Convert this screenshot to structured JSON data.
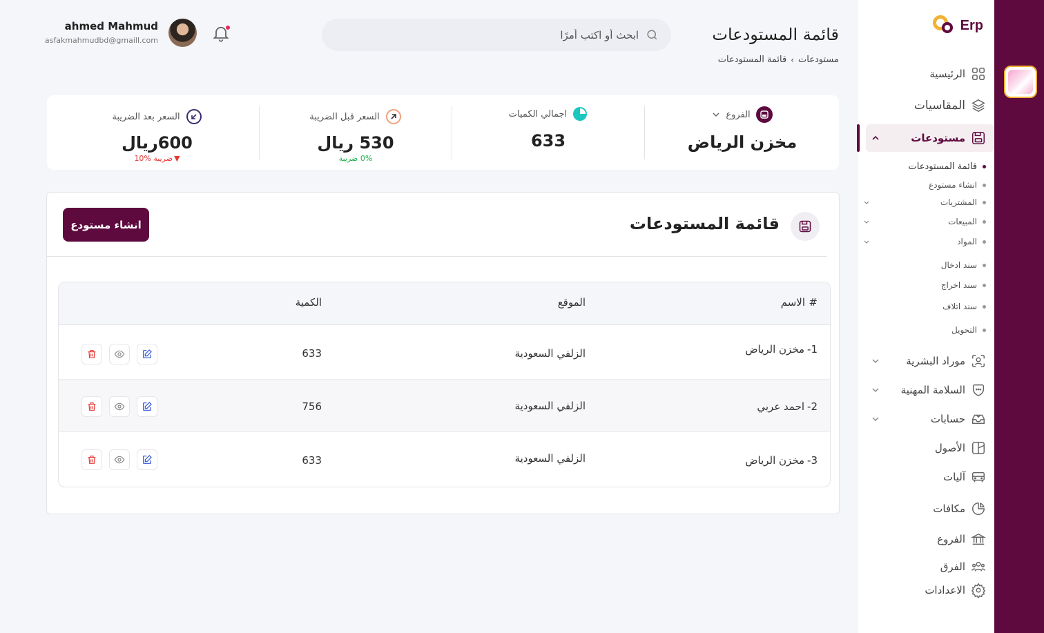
{
  "app": {
    "logo_text": "Erp"
  },
  "header": {
    "title": "قائمة المستودعات",
    "breadcrumb": [
      "مستودعات",
      "قائمة المستودعات"
    ],
    "search_placeholder": "ابحث أو اكتب أمرًا",
    "user": {
      "name": "ahmed Mahmud",
      "email": "asfakmahmudbd@gmaill.com"
    }
  },
  "sidebar": {
    "items": [
      {
        "label": "الرئيسية",
        "icon": "grid-icon"
      },
      {
        "label": "المقاسيات",
        "icon": "layers-icon"
      },
      {
        "label": "مستودعات",
        "icon": "save-icon",
        "active": true,
        "expanded": true
      },
      {
        "label": "موراد البشرية",
        "icon": "user-scan-icon",
        "has_children": true
      },
      {
        "label": "السلامة المهنية",
        "icon": "shield-icon",
        "has_children": true
      },
      {
        "label": "حسابات",
        "icon": "inbox-icon",
        "has_children": true
      },
      {
        "label": "الأصول",
        "icon": "chart-box-icon"
      },
      {
        "label": "آليات",
        "icon": "bus-icon"
      },
      {
        "label": "مكافات",
        "icon": "pie-icon"
      },
      {
        "label": "الفروع",
        "icon": "bank-icon"
      },
      {
        "label": "الفرق",
        "icon": "team-icon"
      },
      {
        "label": "الاعدادات",
        "icon": "gear-icon"
      }
    ],
    "sub_items": [
      {
        "label": "قائمة المستودعات",
        "current": true
      },
      {
        "label": "انشاء مستودع"
      },
      {
        "label": "المشتريات",
        "has_children": true
      },
      {
        "label": "المبيعات",
        "has_children": true
      },
      {
        "label": "المواد",
        "has_children": true
      },
      {
        "label": "سند ادخال"
      },
      {
        "label": "سند اخراج"
      },
      {
        "label": "سند اتلاف"
      },
      {
        "label": "التحويل"
      }
    ]
  },
  "stats": {
    "branch": {
      "label": "الفروع",
      "value": "مخزن الرياض"
    },
    "total_qty": {
      "label": "اجمالي الكميات",
      "value": "633"
    },
    "price_before_tax": {
      "label": "السعر قبل الضريبة",
      "value": "530 ريال",
      "note": "0% ضريبة",
      "note_color": "#22b14c"
    },
    "price_after_tax": {
      "label": "السعر بعد الضريبة",
      "value": "600ريال",
      "note": "10% ضريبة",
      "note_color": "#e53935"
    }
  },
  "warehouse_list": {
    "title": "قائمة المستودعات",
    "create_button": "انشاء مستودع",
    "columns": {
      "index": "#",
      "name": "الاسم",
      "location": "الموقع",
      "quantity": "الكمية"
    },
    "rows": [
      {
        "index": "1-",
        "name": "مخزن الرياض",
        "location": "الزلفي السعودية",
        "quantity": "633"
      },
      {
        "index": "2-",
        "name": "احمد عربي",
        "location": "الزلفي السعودية",
        "quantity": "756"
      },
      {
        "index": "3-",
        "name": "مخزن الرياض",
        "location": "الزلفي السعودية",
        "quantity": "633"
      }
    ]
  },
  "colors": {
    "brand": "#5e0a3e",
    "accent": "#f2b233",
    "danger": "#e53935",
    "success": "#22b14c",
    "teal": "#1cc7c1"
  }
}
